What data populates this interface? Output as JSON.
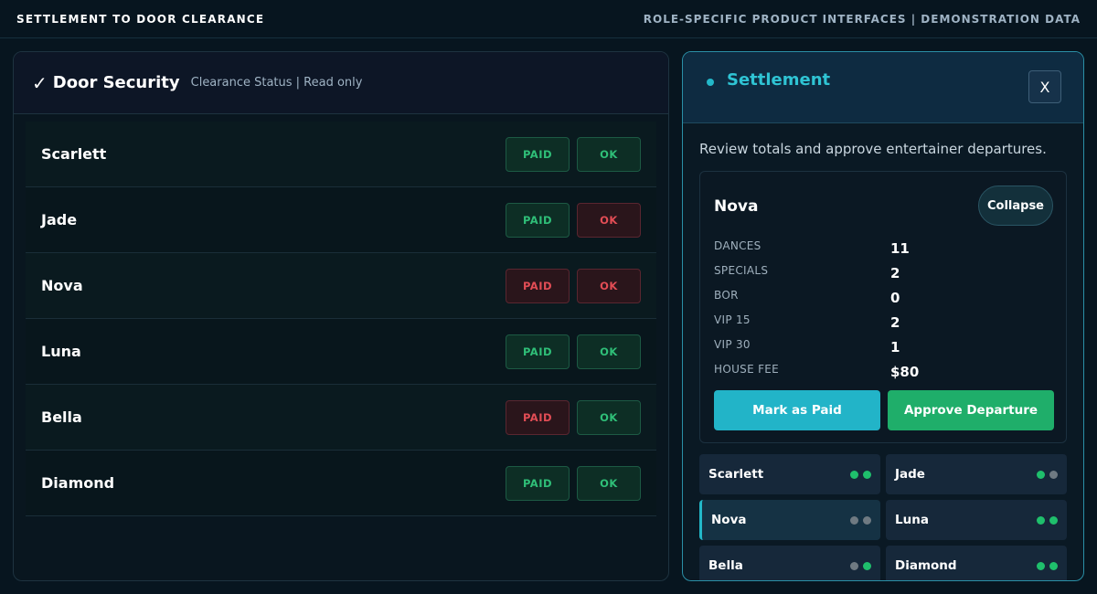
{
  "topbar": {
    "title": "SETTLEMENT TO DOOR CLEARANCE",
    "subtitle": "ROLE-SPECIFIC PRODUCT INTERFACES | DEMONSTRATION DATA"
  },
  "door": {
    "check": "✓",
    "title": "Door Security",
    "subtitle": "Clearance Status | Read only",
    "rows": [
      {
        "name": "Scarlett",
        "paid": "PAID",
        "paid_state": "good",
        "ok": "OK",
        "ok_state": "good"
      },
      {
        "name": "Jade",
        "paid": "PAID",
        "paid_state": "good",
        "ok": "OK",
        "ok_state": "bad"
      },
      {
        "name": "Nova",
        "paid": "PAID",
        "paid_state": "bad",
        "ok": "OK",
        "ok_state": "bad"
      },
      {
        "name": "Luna",
        "paid": "PAID",
        "paid_state": "good",
        "ok": "OK",
        "ok_state": "good"
      },
      {
        "name": "Bella",
        "paid": "PAID",
        "paid_state": "bad",
        "ok": "OK",
        "ok_state": "good"
      },
      {
        "name": "Diamond",
        "paid": "PAID",
        "paid_state": "good",
        "ok": "OK",
        "ok_state": "good"
      }
    ]
  },
  "settlement": {
    "title": "Settlement",
    "close_label": "X",
    "description": "Review totals and approve entertainer departures.",
    "detail": {
      "name": "Nova",
      "collapse_label": "Collapse",
      "stats": [
        {
          "label": "DANCES",
          "value": "11"
        },
        {
          "label": "SPECIALS",
          "value": "2"
        },
        {
          "label": "BOR",
          "value": "0"
        },
        {
          "label": "VIP 15",
          "value": "2"
        },
        {
          "label": "VIP 30",
          "value": "1"
        },
        {
          "label": "HOUSE FEE",
          "value": "$80"
        }
      ],
      "mark_paid_label": "Mark as Paid",
      "approve_label": "Approve Departure"
    },
    "list": [
      {
        "name": "Scarlett",
        "paid": true,
        "approved": true,
        "selected": false
      },
      {
        "name": "Jade",
        "paid": true,
        "approved": false,
        "selected": false
      },
      {
        "name": "Nova",
        "paid": false,
        "approved": false,
        "selected": true
      },
      {
        "name": "Luna",
        "paid": true,
        "approved": true,
        "selected": false
      },
      {
        "name": "Bella",
        "paid": false,
        "approved": true,
        "selected": false
      },
      {
        "name": "Diamond",
        "paid": true,
        "approved": true,
        "selected": false
      }
    ]
  },
  "colors": {
    "accent": "#23b8c9",
    "good": "#1fbf6c",
    "bad": "#e24d55"
  }
}
